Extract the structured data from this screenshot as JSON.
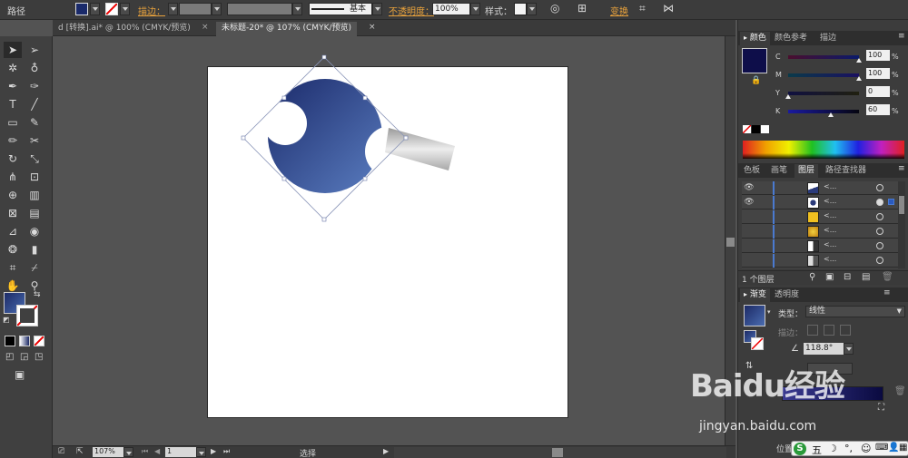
{
  "control_bar": {
    "object_type": "路径",
    "stroke_label": "描边：",
    "brush_label": "基本",
    "opacity_label": "不透明度：",
    "opacity_value": "100%",
    "style_label": "样式：",
    "transform_label": "变换"
  },
  "tabs": [
    {
      "label": "d [转换].ai* @ 100% (CMYK/预览)"
    },
    {
      "label": "未标题-20* @ 107% (CMYK/预览)"
    }
  ],
  "status": {
    "zoom": "107%",
    "page": "1",
    "mode": "选择"
  },
  "color_panel": {
    "tabs": [
      "颜色",
      "颜色参考",
      "描边"
    ],
    "channels": [
      {
        "name": "C",
        "value": "100",
        "unit": "%",
        "level": 1.0
      },
      {
        "name": "M",
        "value": "100",
        "unit": "%",
        "level": 1.0
      },
      {
        "name": "Y",
        "value": "0",
        "unit": "%",
        "level": 0.0
      },
      {
        "name": "K",
        "value": "60",
        "unit": "%",
        "level": 0.6
      }
    ],
    "fill_color": "#0e0e4a"
  },
  "layers_panel": {
    "tabs": [
      "色板",
      "画笔",
      "图层",
      "路径查找器"
    ],
    "rows": [
      {
        "name": "<..."
      },
      {
        "name": "<..."
      },
      {
        "name": "<..."
      },
      {
        "name": "<..."
      },
      {
        "name": "<..."
      },
      {
        "name": "<..."
      }
    ],
    "count_label": "1 个图层"
  },
  "gradient_panel": {
    "tabs": [
      "渐变",
      "透明度"
    ],
    "type_label": "类型：",
    "type_value": "线性",
    "stroke_label": "描边：",
    "angle_value": "118.8°",
    "location_label": "位置"
  },
  "watermark": {
    "brand": "Baidu经验",
    "url": "jingyan.baidu.com"
  },
  "tray": {
    "ime": "五"
  }
}
